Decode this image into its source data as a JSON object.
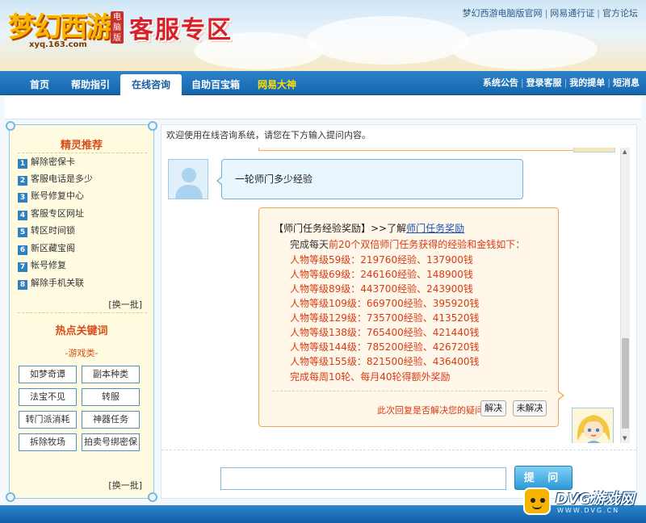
{
  "header": {
    "logo_text": "梦幻西游",
    "logo_badge": "电脑版",
    "logo_domain": "xyq.163.com",
    "zone_title": "客服专区",
    "top_links": [
      "梦幻西游电脑版官网",
      "网易通行证",
      "官方论坛"
    ]
  },
  "nav": {
    "items": [
      "首页",
      "帮助指引",
      "在线咨询",
      "自助百宝箱",
      "网易大神"
    ],
    "active": "在线咨询",
    "right_links": [
      "系统公告",
      "登录客服",
      "我的提单",
      "短消息"
    ]
  },
  "sidebar": {
    "faq_title": "精灵推荐",
    "faq_items": [
      {
        "num": "1",
        "label": "解除密保卡"
      },
      {
        "num": "2",
        "label": "客服电话是多少"
      },
      {
        "num": "3",
        "label": "账号修复中心"
      },
      {
        "num": "4",
        "label": "客服专区网址"
      },
      {
        "num": "5",
        "label": "转区时间锁"
      },
      {
        "num": "6",
        "label": "新区藏宝阁"
      },
      {
        "num": "7",
        "label": "帐号修复"
      },
      {
        "num": "8",
        "label": "解除手机关联"
      }
    ],
    "swap_label": "[换一批]",
    "keywords_title": "热点关键词",
    "keywords_sub": "-游戏类-",
    "keywords": [
      "如梦奇谭",
      "副本种类",
      "法宝不见",
      "转服",
      "转门派消耗",
      "神器任务",
      "拆除牧场",
      "拍卖号绑密保"
    ],
    "swap_label_2": "[换一批]"
  },
  "main": {
    "welcome": "欢迎使用在线咨询系统，请您在下方输入提问内容。",
    "user_message": "一轮师门多少经验",
    "answer": {
      "title_prefix": "【师门任务经验奖励】>>了解",
      "title_link": "师门任务奖励",
      "intro_a": "完成每天",
      "intro_b": "前20个双倍师门任务获得的经验和金钱如下：",
      "rows": [
        "人物等级59级：219760经验、137900钱",
        "人物等级69级：246160经验、148900钱",
        "人物等级89级：443700经验、243900钱",
        "人物等级109级：669700经验、395920钱",
        "人物等级129级：735700经验、413520钱",
        "人物等级138级：765400经验、421440钱",
        "人物等级144级：785200经验、426720钱",
        "人物等级155级：821500经验、436400钱"
      ],
      "footer_line": "完成每周10轮、每月40轮得额外奖励",
      "resolve_question": "此次回复是否解决您的疑问：",
      "resolved_label": "解决",
      "unresolved_label": "未解决"
    },
    "input_value": "",
    "ask_label": "提 问"
  },
  "watermark": {
    "text": "DVG游戏网",
    "sub": "WWW.DVG.CN"
  },
  "colors": {
    "nav_blue": "#1a6fb8",
    "answer_red": "#d93a12",
    "sidebar_title": "#d84c18",
    "link_blue": "#1a4fb5"
  }
}
